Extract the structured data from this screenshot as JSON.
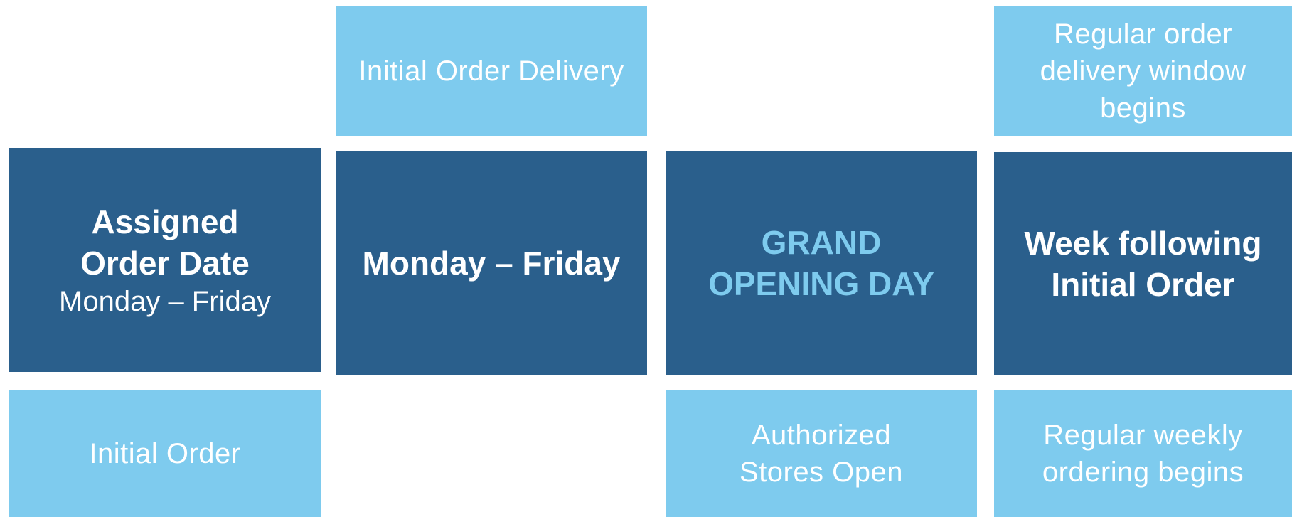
{
  "diagram": {
    "top_row": {
      "initial_order_delivery": {
        "lines": [
          "Initial Order Delivery"
        ]
      },
      "regular_delivery_window": {
        "lines": [
          "Regular order",
          "delivery window",
          "begins"
        ]
      }
    },
    "middle_row": {
      "assigned_order_date": {
        "title_lines": [
          "Assigned",
          "Order Date"
        ],
        "subtitle": "Monday  – Friday"
      },
      "monday_friday": {
        "lines": [
          "Monday – Friday"
        ]
      },
      "grand_opening": {
        "lines": [
          "GRAND",
          "OPENING DAY"
        ]
      },
      "week_following": {
        "lines": [
          "Week following",
          "Initial Order"
        ]
      }
    },
    "bottom_row": {
      "initial_order": {
        "lines": [
          "Initial Order"
        ]
      },
      "authorized_stores_open": {
        "lines": [
          "Authorized",
          "Stores Open"
        ]
      },
      "regular_weekly_ordering": {
        "lines": [
          "Regular  weekly",
          "ordering begins"
        ]
      }
    },
    "colors": {
      "light_blue": "#7ecbee",
      "dark_blue": "#2a5f8c",
      "text_white": "#ffffff"
    }
  }
}
